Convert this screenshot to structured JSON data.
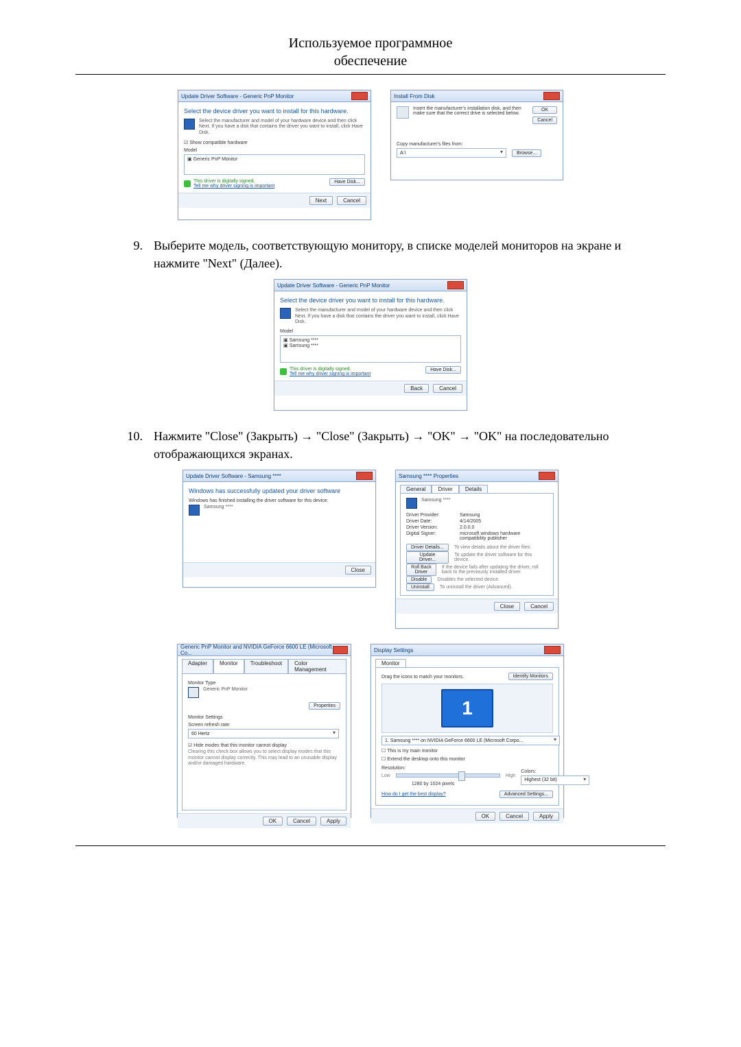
{
  "header": {
    "line1": "Используемое программное",
    "line2": "обеспечение"
  },
  "steps": {
    "nine": {
      "num": "9.",
      "text": "Выберите модель, соответствующую монитору, в списке моделей мониторов на экране и нажмите \"Next\" (Далее)."
    },
    "ten": {
      "num": "10.",
      "text": "Нажмите \"Close\" (Закрыть) → \"Close\" (Закрыть) → \"OK\" → \"OK\" на последовательно отображающихся экранах."
    }
  },
  "buttons": {
    "ok": "OK",
    "cancel": "Cancel",
    "browse": "Browse...",
    "next": "Next",
    "back": "Back",
    "close": "Close",
    "apply": "Apply",
    "have_disk": "Have Disk...",
    "properties": "Properties",
    "driver_details": "Driver Details...",
    "update_driver": "Update Driver...",
    "roll_back": "Roll Back Driver",
    "disable": "Disable",
    "uninstall": "Uninstall",
    "identify": "Identify Monitors",
    "advanced": "Advanced Settings..."
  },
  "dialogs": {
    "update_pnp": {
      "title": "Update Driver Software - Generic PnP Monitor",
      "heading": "Select the device driver you want to install for this hardware.",
      "hint": "Select the manufacturer and model of your hardware device and then click Next. If you have a disk that contains the driver you want to install, click Have Disk.",
      "compat_label": "Show compatible hardware",
      "model_label": "Model",
      "model_item": "Generic PnP Monitor",
      "signed": "This driver is digitally signed.",
      "signed_link": "Tell me why driver signing is important"
    },
    "install_from_disk": {
      "title": "Install From Disk",
      "hint": "Insert the manufacturer's installation disk, and then make sure that the correct drive is selected below.",
      "copy_label": "Copy manufacturer's files from:",
      "path": "A:\\"
    },
    "update_model": {
      "title": "Update Driver Software - Generic PnP Monitor",
      "heading": "Select the device driver you want to install for this hardware.",
      "hint": "Select the manufacturer and model of your hardware device and then click Next. If you have a disk that contains the driver you want to install, click Have Disk.",
      "model_label": "Model",
      "model_a": "Samsung ****",
      "model_b": "Samsung ****",
      "signed": "This driver is digitally signed.",
      "signed_link": "Tell me why driver signing is important"
    },
    "update_done": {
      "title": "Update Driver Software - Samsung ****",
      "heading": "Windows has successfully updated your driver software",
      "line": "Windows has finished installing the driver software for this device:",
      "device": "Samsung ****"
    },
    "driver_props": {
      "title": "Samsung **** Properties",
      "tabs": {
        "general": "General",
        "driver": "Driver",
        "details": "Details"
      },
      "device": "Samsung ****",
      "provider_k": "Driver Provider:",
      "provider_v": "Samsung",
      "date_k": "Driver Date:",
      "date_v": "4/14/2005",
      "version_k": "Driver Version:",
      "version_v": "2.0.0.0",
      "signer_k": "Digital Signer:",
      "signer_v": "microsoft windows hardware compatibility publisher",
      "desc_details": "To view details about the driver files.",
      "desc_update": "To update the driver software for this device.",
      "desc_rollback": "If the device fails after updating the driver, roll back to the previously installed driver.",
      "desc_disable": "Disables the selected device.",
      "desc_uninstall": "To uninstall the driver (Advanced)."
    },
    "monitor_props": {
      "title": "Generic PnP Monitor and NVIDIA GeForce 6600 LE (Microsoft Co...",
      "tabs": {
        "adapter": "Adapter",
        "monitor": "Monitor",
        "troubleshoot": "Troubleshoot",
        "color": "Color Management"
      },
      "type_label": "Monitor Type",
      "type_value": "Generic PnP Monitor",
      "settings_label": "Monitor Settings",
      "refresh_label": "Screen refresh rate:",
      "refresh_value": "60 Hertz",
      "hide_label": "Hide modes that this monitor cannot display",
      "hide_desc": "Clearing this check box allows you to select display modes that this monitor cannot display correctly. This may lead to an unusable display and/or damaged hardware."
    },
    "display_settings": {
      "title": "Display Settings",
      "tab": "Monitor",
      "drag_label": "Drag the icons to match your monitors.",
      "selected": "1. Samsung **** on NVIDIA GeForce 6600 LE (Microsoft Corpo...",
      "primary": "This is my main monitor",
      "extend": "Extend the desktop onto this monitor",
      "res_label": "Resolution:",
      "low": "Low",
      "high": "High",
      "res_value": "1280 by 1024 pixels",
      "colors_label": "Colors:",
      "colors_value": "Highest (32 bit)",
      "help_link": "How do I get the best display?"
    }
  }
}
